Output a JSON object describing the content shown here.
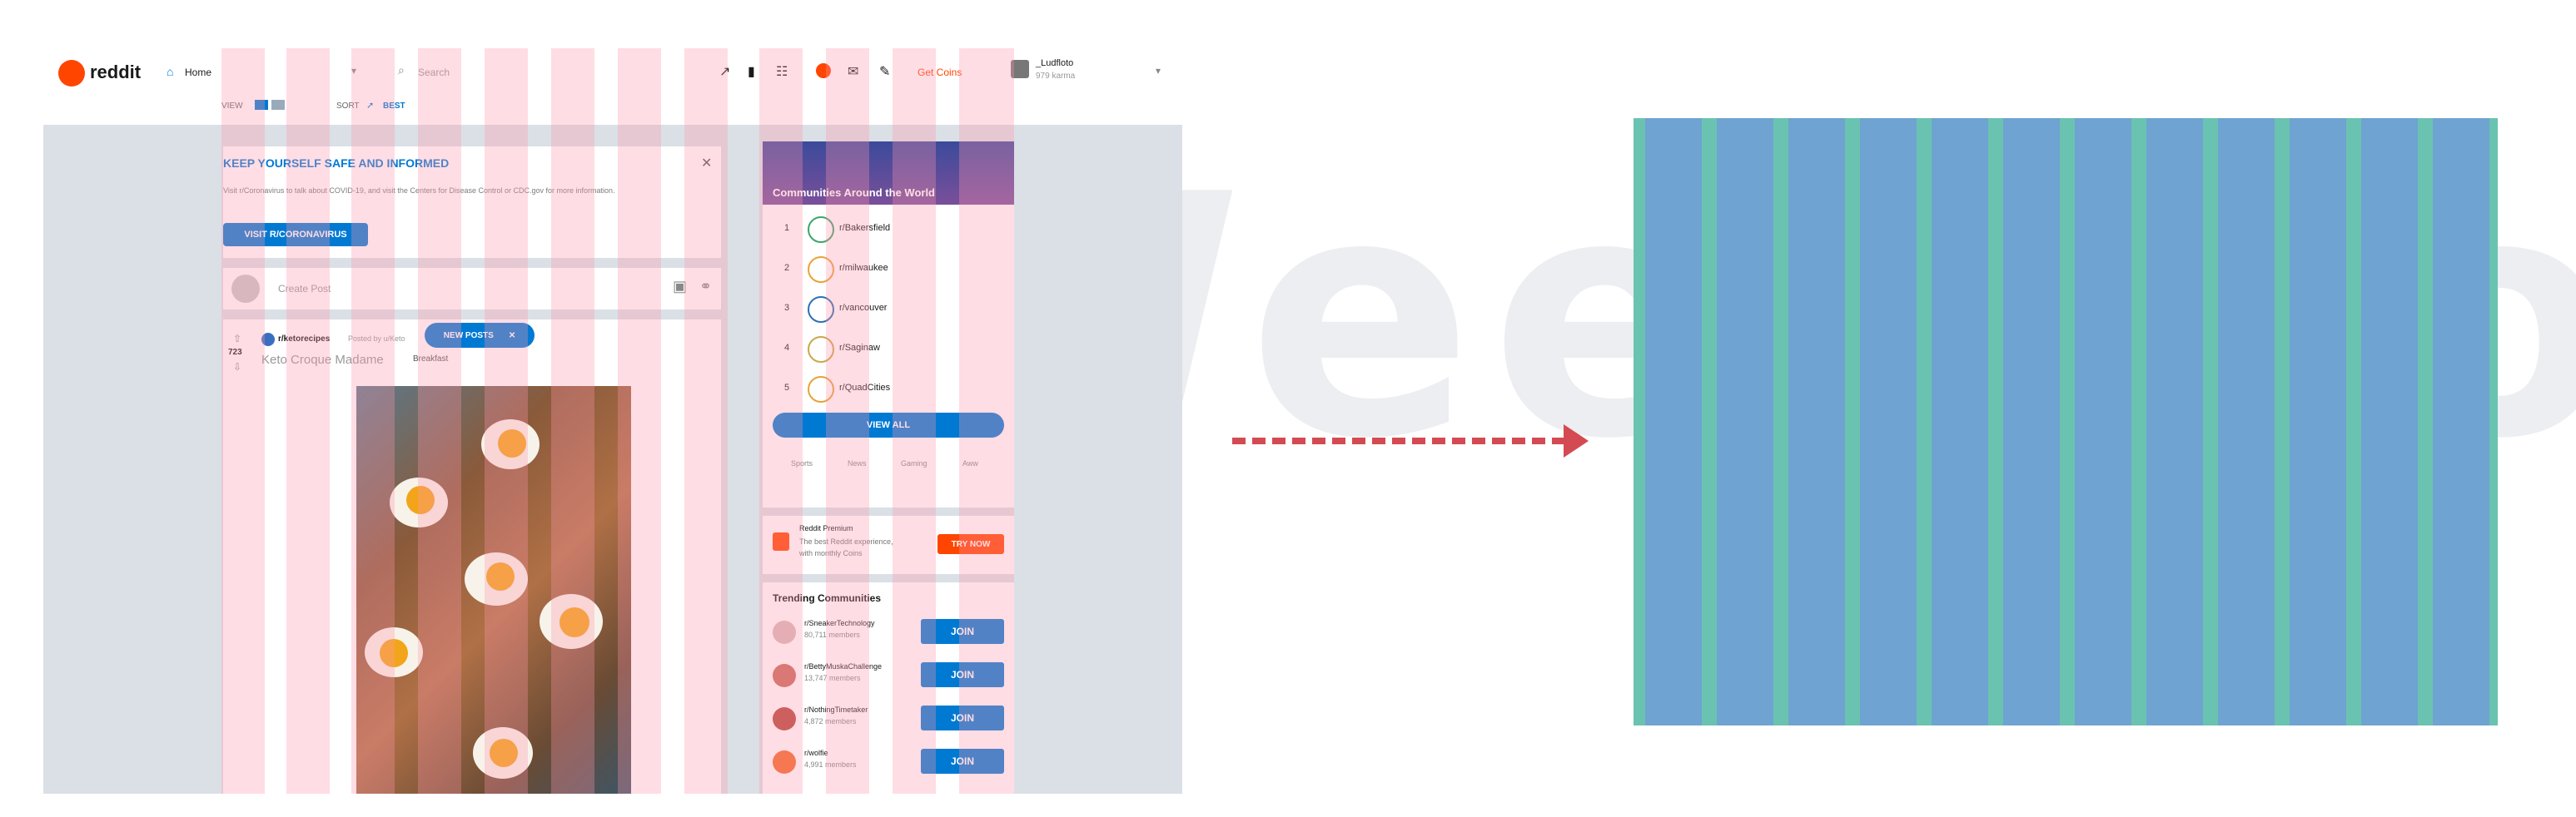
{
  "watermark": {
    "text": "5UXWeekerom"
  },
  "header": {
    "brand": "reddit",
    "home_label": "Home",
    "search_placeholder": "Search",
    "coins_label": "Get Coins",
    "username": "_Ludfloto",
    "karma": "979 karma",
    "view_label": "VIEW",
    "sort_label": "SORT",
    "sort_value": "BEST"
  },
  "banner": {
    "title": "KEEP YOURSELF SAFE AND INFORMED",
    "body": "Visit r/Coronavirus to talk about COVID-19, and visit the Centers for Disease Control or CDC.gov for more information.",
    "button": "VISIT R/CORONAVIRUS",
    "close": "✕"
  },
  "create_post": {
    "placeholder": "Create Post"
  },
  "new_posts": {
    "label": "NEW POSTS",
    "close": "✕"
  },
  "post": {
    "subreddit": "r/ketorecipes",
    "posted_by": "Posted by u/Keto",
    "votes": "723",
    "title": "Keto Croque Madame",
    "flair": "Breakfast"
  },
  "sidebar": {
    "communities_title": "Communities Around the World",
    "communities": [
      {
        "rank": "1",
        "name": "r/Bakersfield",
        "color": "#3fa36b"
      },
      {
        "rank": "2",
        "name": "r/milwaukee",
        "color": "#e8a23a"
      },
      {
        "rank": "3",
        "name": "r/vancouver",
        "color": "#2f6fb3"
      },
      {
        "rank": "4",
        "name": "r/Saginaw",
        "color": "#c9a84a"
      },
      {
        "rank": "5",
        "name": "r/QuadCities",
        "color": "#e6a33a"
      }
    ],
    "view_all": "VIEW ALL",
    "region_tabs": [
      "Sports",
      "News",
      "Gaming",
      "Aww"
    ],
    "premium": {
      "title": "Reddit Premium",
      "line1": "The best Reddit experience,",
      "line2": "with monthly Coins",
      "button": "TRY NOW"
    },
    "trending_title": "Trending Communities",
    "trending": [
      {
        "name": "r/SneakerTechnology",
        "members": "80,711 members",
        "join": "JOIN"
      },
      {
        "name": "r/BettyMuskaChallenge",
        "members": "13,747 members",
        "join": "JOIN"
      },
      {
        "name": "r/NothingTimetaker",
        "members": "4,872 members",
        "join": "JOIN"
      },
      {
        "name": "r/wolfie",
        "members": "4,991 members",
        "join": "JOIN"
      }
    ]
  },
  "colors": {
    "reddit_orange": "#ff4500",
    "reddit_blue": "#0079d3",
    "feed_bg": "#dae0e6",
    "grid_overlay": "#ffc0cc",
    "arrow": "#d44a52",
    "gutter_green": "#6ac3b0",
    "column_blue": "#6fa3d1"
  },
  "grid_diagram": {
    "columns": 12
  }
}
